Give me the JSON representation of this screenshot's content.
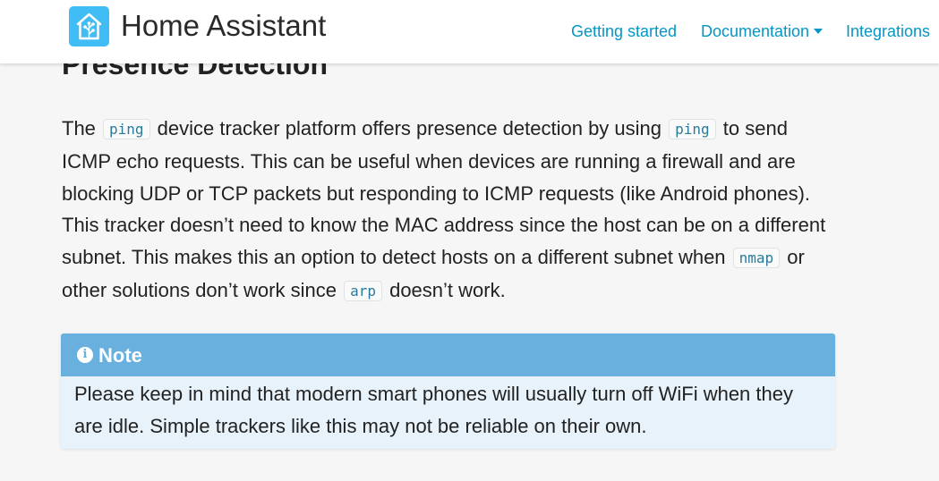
{
  "header": {
    "site_title": "Home Assistant",
    "nav": [
      {
        "label": "Getting started"
      },
      {
        "label": "Documentation"
      },
      {
        "label": "Integrations"
      }
    ]
  },
  "content": {
    "heading": "Presence Detection",
    "paragraph": {
      "t1": "The ",
      "c1": "ping",
      "t2": " device tracker platform offers presence detection by using ",
      "c2": "ping",
      "t3": " to send ICMP echo requests. This can be useful when devices are running a firewall and are blocking UDP or TCP packets but responding to ICMP requests (like Android phones). This tracker doesn’t need to know the MAC address since the host can be on a different subnet. This makes this an option to detect hosts on a different subnet when ",
      "c3": "nmap",
      "t4": " or other solutions don’t work since ",
      "c4": "arp",
      "t5": " doesn’t work."
    },
    "note": {
      "icon_glyph": "i",
      "title": "Note",
      "body": "Please keep in mind that modern smart phones will usually turn off WiFi when they are idle. Simple trackers like this may not be reliable on their own."
    }
  },
  "colors": {
    "brand": "#41bdf5",
    "link": "#0396c7",
    "note_header": "#6ab0de",
    "note_body": "#e7f2fa"
  },
  "icons": {
    "logo": "home-assistant-logo-icon",
    "dropdown": "caret-down-icon",
    "note": "info-circle-icon"
  }
}
